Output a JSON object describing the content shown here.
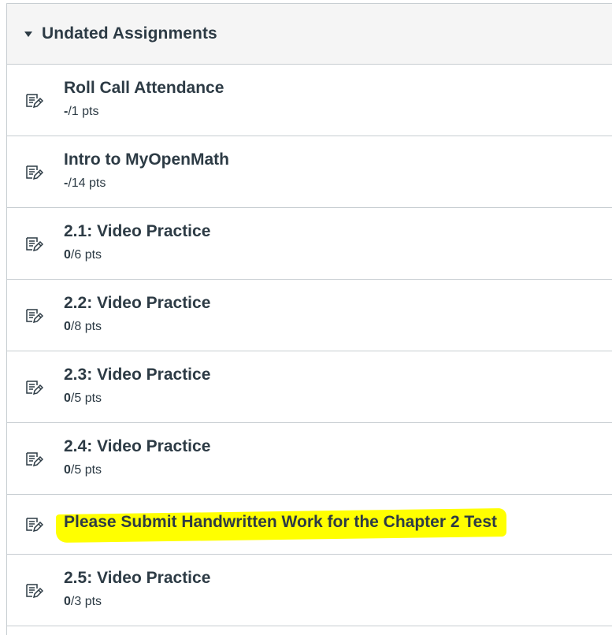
{
  "group": {
    "title": "Undated Assignments",
    "icon": "caret-down-icon"
  },
  "items": [
    {
      "title": "Roll Call Attendance",
      "score": "-",
      "total": "/1 pts",
      "icon": "assignment-icon"
    },
    {
      "title": "Intro to MyOpenMath",
      "score": "-",
      "total": "/14 pts",
      "icon": "assignment-icon"
    },
    {
      "title": "2.1: Video Practice",
      "score": "0",
      "total": "/6 pts",
      "icon": "assignment-icon"
    },
    {
      "title": "2.2: Video Practice",
      "score": "0",
      "total": "/8 pts",
      "icon": "assignment-icon"
    },
    {
      "title": "2.3: Video Practice",
      "score": "0",
      "total": "/5 pts",
      "icon": "assignment-icon"
    },
    {
      "title": "2.4: Video Practice",
      "score": "0",
      "total": "/5 pts",
      "icon": "assignment-icon"
    },
    {
      "title": "Please Submit Handwritten Work for the Chapter 2 Test",
      "icon": "assignment-icon",
      "highlight_color": "#ffff00"
    },
    {
      "title": "2.5: Video Practice",
      "score": "0",
      "total": "/3 pts",
      "icon": "assignment-icon"
    }
  ]
}
